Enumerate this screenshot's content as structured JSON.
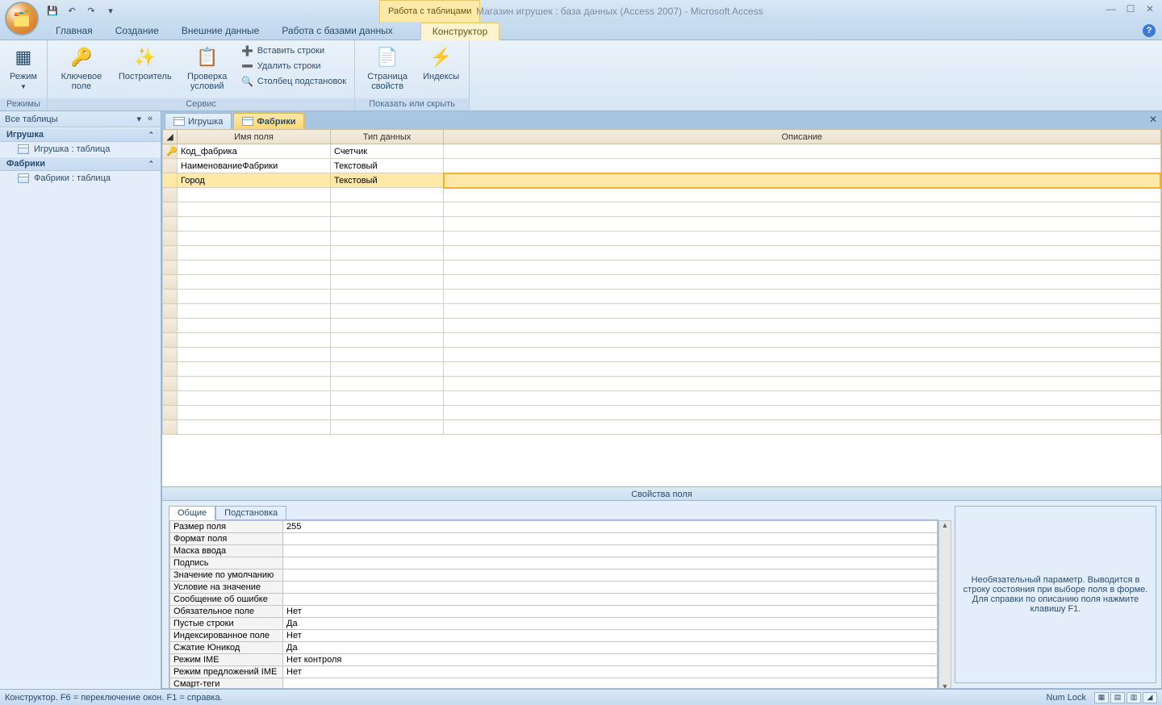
{
  "titlebar": {
    "context_label": "Работа с таблицами",
    "title": "Магазин игрушек : база данных (Access 2007) - Microsoft Access"
  },
  "ribbon_tabs": {
    "home": "Главная",
    "create": "Создание",
    "external": "Внешние данные",
    "dbtools": "Работа с базами данных",
    "design": "Конструктор"
  },
  "ribbon": {
    "views_group": "Режимы",
    "view_btn": "Режим",
    "tools_group": "Сервис",
    "primary_key": "Ключевое поле",
    "builder": "Построитель",
    "test_rules": "Проверка условий",
    "insert_rows": "Вставить строки",
    "delete_rows": "Удалить строки",
    "lookup_col": "Столбец подстановок",
    "showhide_group": "Показать или скрыть",
    "prop_sheet": "Страница свойств",
    "indexes": "Индексы"
  },
  "nav": {
    "header": "Все таблицы",
    "group1": "Игрушка",
    "item1": "Игрушка : таблица",
    "group2": "Фабрики",
    "item2": "Фабрики : таблица"
  },
  "tabs": {
    "tab1": "Игрушка",
    "tab2": "Фабрики"
  },
  "grid": {
    "col_name": "Имя поля",
    "col_type": "Тип данных",
    "col_desc": "Описание",
    "rows": [
      {
        "key": true,
        "name": "Код_фабрика",
        "type": "Счетчик"
      },
      {
        "key": false,
        "name": "НаименованиеФабрики",
        "type": "Текстовый"
      },
      {
        "key": false,
        "name": "Город",
        "type": "Текстовый"
      }
    ]
  },
  "properties": {
    "title": "Свойства поля",
    "tab_general": "Общие",
    "tab_lookup": "Подстановка",
    "rows": [
      {
        "label": "Размер поля",
        "value": "255"
      },
      {
        "label": "Формат поля",
        "value": ""
      },
      {
        "label": "Маска ввода",
        "value": ""
      },
      {
        "label": "Подпись",
        "value": ""
      },
      {
        "label": "Значение по умолчанию",
        "value": ""
      },
      {
        "label": "Условие на значение",
        "value": ""
      },
      {
        "label": "Сообщение об ошибке",
        "value": ""
      },
      {
        "label": "Обязательное поле",
        "value": "Нет"
      },
      {
        "label": "Пустые строки",
        "value": "Да"
      },
      {
        "label": "Индексированное поле",
        "value": "Нет"
      },
      {
        "label": "Сжатие Юникод",
        "value": "Да"
      },
      {
        "label": "Режим IME",
        "value": "Нет контроля"
      },
      {
        "label": "Режим предложений IME",
        "value": "Нет"
      },
      {
        "label": "Смарт-теги",
        "value": ""
      }
    ],
    "help_text": "Необязательный параметр.  Выводится в строку состояния при выборе поля в форме.  Для справки по описанию поля нажмите клавишу F1."
  },
  "status": {
    "left": "Конструктор.  F6 = переключение окон.  F1 = справка.",
    "numlock": "Num Lock"
  }
}
